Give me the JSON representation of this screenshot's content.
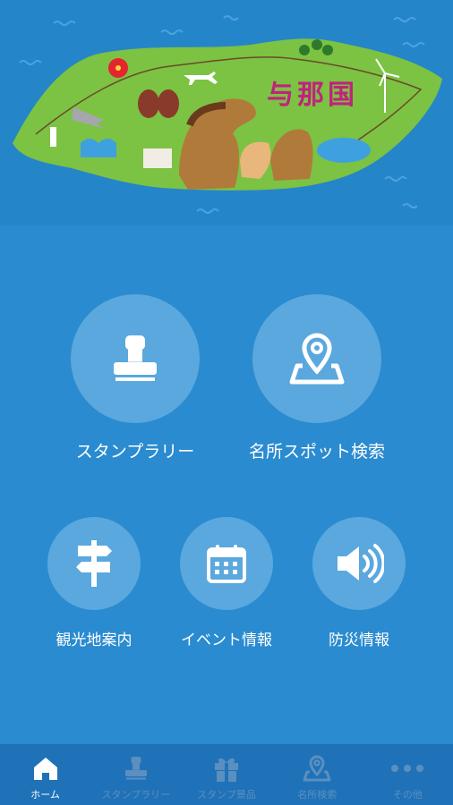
{
  "hero": {
    "title": "与那国",
    "icon": "yonaguni-island-illustration"
  },
  "menu": {
    "stamp_rally": {
      "label": "スタンプラリー",
      "icon": "stamp-icon"
    },
    "spot_search": {
      "label": "名所スポット検索",
      "icon": "map-pin-icon"
    },
    "sightseeing": {
      "label": "観光地案内",
      "icon": "signpost-icon"
    },
    "events": {
      "label": "イベント情報",
      "icon": "calendar-icon"
    },
    "disaster": {
      "label": "防災情報",
      "icon": "speaker-icon"
    }
  },
  "tabs": [
    {
      "label": "ホーム",
      "icon": "home-icon",
      "active": true
    },
    {
      "label": "スタンプラリー",
      "icon": "stamp-icon",
      "active": false
    },
    {
      "label": "スタンプ景品",
      "icon": "gift-icon",
      "active": false
    },
    {
      "label": "名所検索",
      "icon": "map-pin-icon",
      "active": false
    },
    {
      "label": "その他",
      "icon": "more-icon",
      "active": false
    }
  ],
  "colors": {
    "background": "#2a8bd0",
    "sea": "#2585c9",
    "island": "#7cc243",
    "button": "#5aa8de",
    "tabbar": "#1f72b8",
    "tab_inactive": "#5b8fbf"
  }
}
